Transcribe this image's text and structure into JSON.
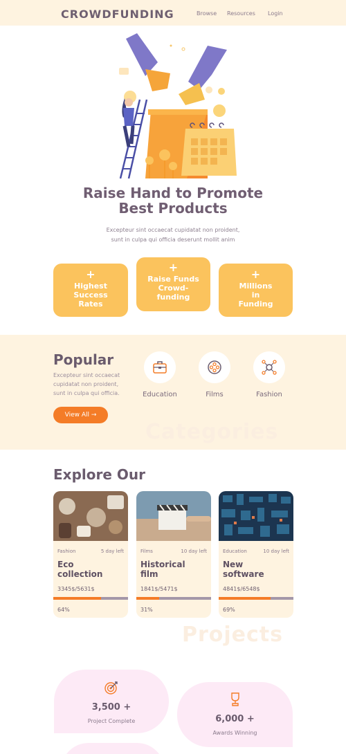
{
  "header": {
    "logo": "CROWDFUNDING",
    "nav": [
      "Browse",
      "Resources",
      "Login"
    ]
  },
  "hero": {
    "title_line1": "Raise Hand to Promote",
    "title_line2": "Best Products",
    "text_line1": "Excepteur sint occaecat cupidatat non proident,",
    "text_line2": "sunt in culpa qui officia deserunt mollit anim"
  },
  "features": [
    {
      "lines": [
        "Highest",
        "Success",
        "Rates"
      ]
    },
    {
      "lines": [
        "Raise Funds",
        "Crowd-",
        "funding"
      ]
    },
    {
      "lines": [
        "Millions",
        "in",
        "Funding"
      ]
    }
  ],
  "popular": {
    "title": "Popular",
    "text_line1": "Excepteur sint occaecat",
    "text_line2": "cupidatat non proident,",
    "text_line3": "sunt in culpa qui officia.",
    "button": "View All →",
    "ghost": "Categories",
    "categories": [
      {
        "label": "Education",
        "icon": "briefcase-icon"
      },
      {
        "label": "Films",
        "icon": "film-reel-icon"
      },
      {
        "label": "Fashion",
        "icon": "network-icon"
      }
    ]
  },
  "explore": {
    "title": "Explore Our",
    "ghost": "Projects",
    "cards": [
      {
        "category": "Fashion",
        "days": "5 day left",
        "title_line1": "Eco",
        "title_line2": "collection",
        "amount": "3345$/5631$",
        "percent": "64%",
        "progress": 0.64
      },
      {
        "category": "Films",
        "days": "10 day left",
        "title_line1": "Historical",
        "title_line2": "film",
        "amount": "1841$/5471$",
        "percent": "31%",
        "progress": 0.31
      },
      {
        "category": "Education",
        "days": "10 day left",
        "title_line1": "New",
        "title_line2": "software",
        "amount": "4841$/6548$",
        "percent": "69%",
        "progress": 0.69
      }
    ]
  },
  "stats": [
    {
      "number": "3,500 +",
      "label": "Project Complete",
      "icon": "target-icon"
    },
    {
      "number": "6,000 +",
      "label": "Awards Winning",
      "icon": "trophy-icon"
    }
  ],
  "colors": {
    "accent": "#f47c27",
    "feature": "#fbc35d",
    "cream": "#fef3e0",
    "pink": "#fdeaf6"
  }
}
